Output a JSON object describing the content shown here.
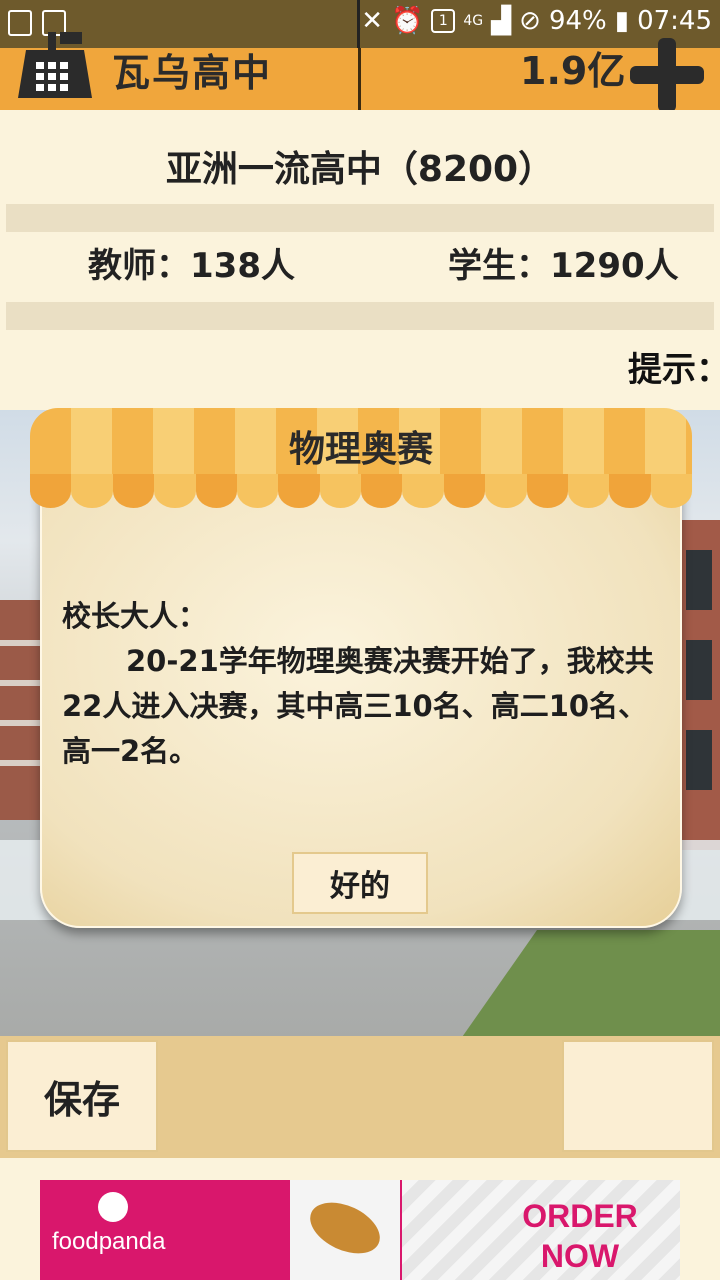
{
  "status_bar": {
    "battery": "94%",
    "time": "07:45",
    "network": "4G",
    "sim_badge": "1"
  },
  "header": {
    "school_name": "瓦乌高中",
    "money": "1.9亿",
    "add_icon": "plus-icon",
    "calculator_icon": "calculator-icon"
  },
  "info": {
    "rank_title": "亚洲一流高中（8200）",
    "teachers": "教师：138人",
    "students": "学生：1290人",
    "hint": "提示："
  },
  "dialog": {
    "title": "物理奥赛",
    "greeting": "校长大人：",
    "body": "20-21学年物理奥赛决赛开始了，我校共22人进入决赛，其中高三10名、高二10名、高一2名。",
    "ok_label": "好的"
  },
  "bottom": {
    "save_label": "保存"
  },
  "ad": {
    "brand": "foodpanda",
    "cta_line1": "ORDER",
    "cta_line2": "NOW",
    "brand_color": "#d9176c"
  }
}
